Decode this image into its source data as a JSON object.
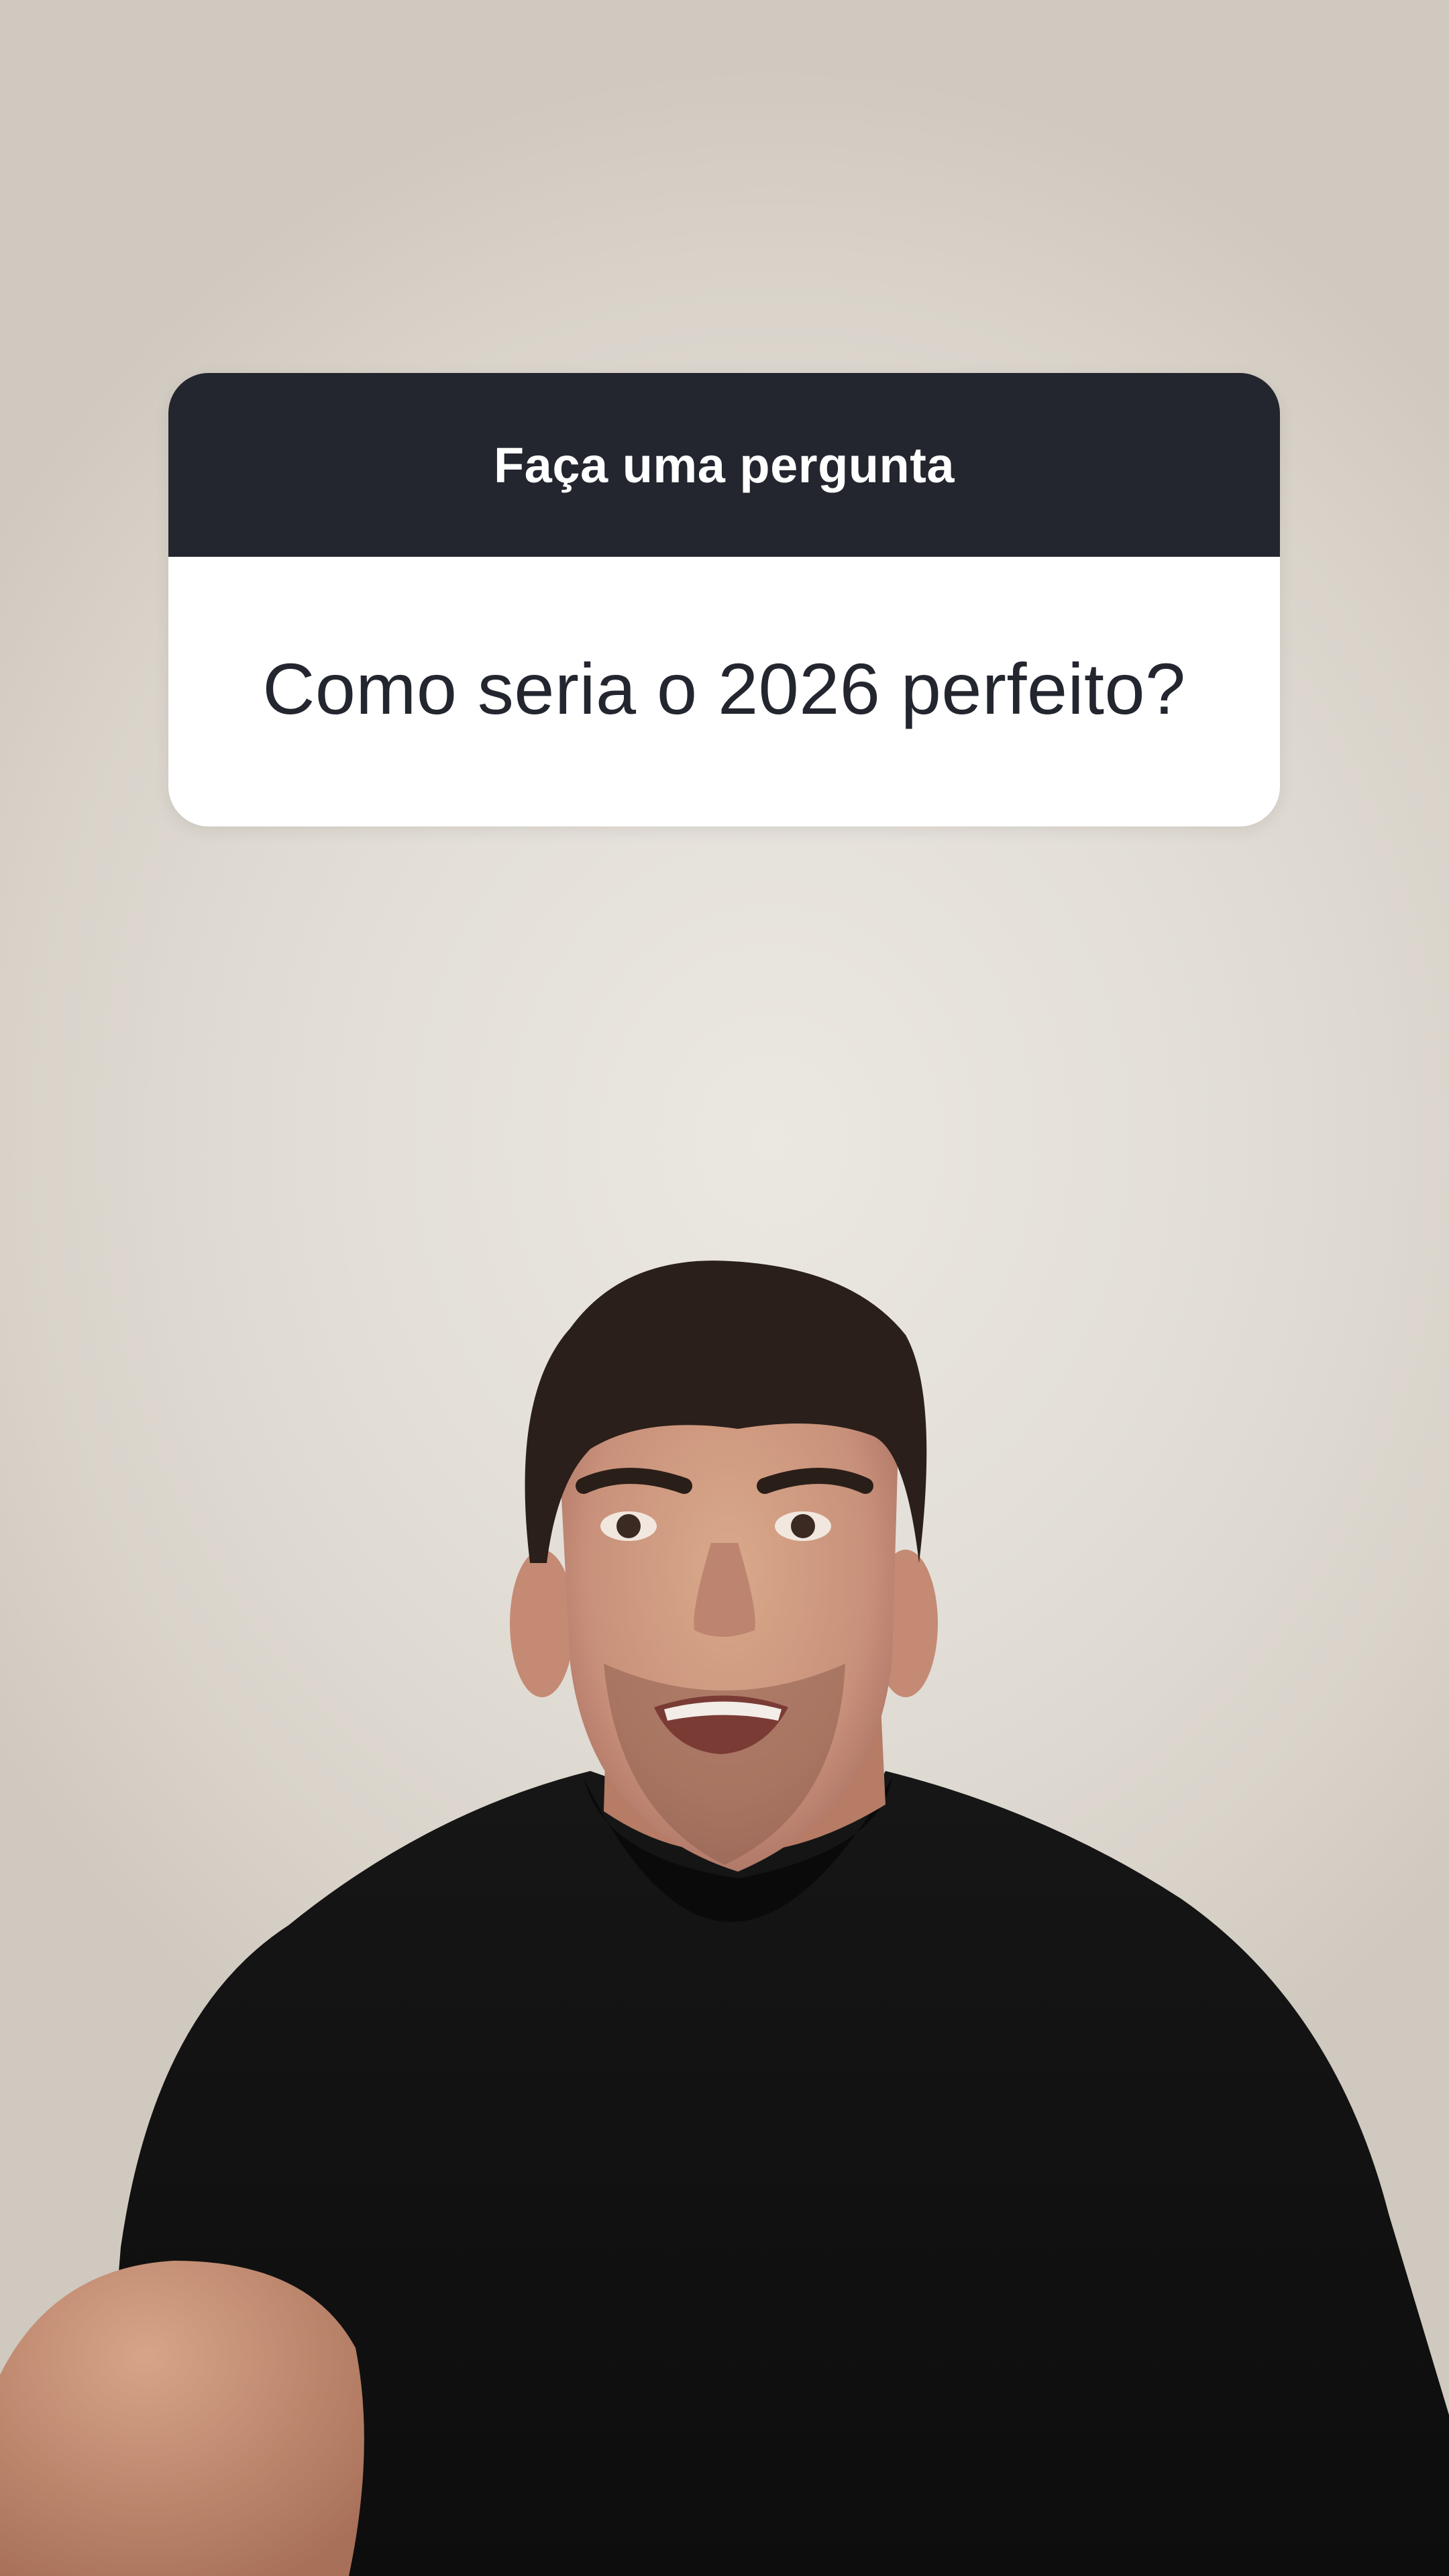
{
  "story": {
    "question_sticker": {
      "header_label": "Faça uma pergunta",
      "question_text": "Como seria o 2026 perfeito?"
    }
  },
  "colors": {
    "sticker_header_bg": "#23262f",
    "sticker_body_bg": "#ffffff",
    "background_wall": "#e3dfd8"
  }
}
